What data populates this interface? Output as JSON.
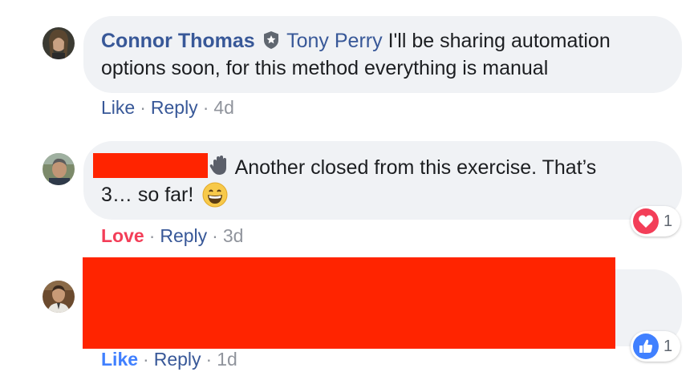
{
  "comments": [
    {
      "author": "Connor Thomas",
      "mention": "Tony Perry",
      "text_line1": "I'll be sharing automation",
      "text_line2": "options soon, for this method everything is manual",
      "actions": {
        "like": "Like",
        "reply": "Reply",
        "time": "4d"
      }
    },
    {
      "text_line1": "Another closed from this exercise. That’s",
      "text_line2": "3… so far!",
      "actions": {
        "like": "Love",
        "reply": "Reply",
        "time": "3d"
      },
      "reaction": {
        "type": "love",
        "count": "1"
      }
    },
    {
      "actions": {
        "like": "Like",
        "reply": "Reply",
        "time": "1d"
      },
      "reaction": {
        "type": "like",
        "count": "1"
      }
    }
  ],
  "colors": {
    "author": "#385898",
    "love": "#f33e58",
    "like_active": "#4080ff",
    "redaction": "#ff2400",
    "bubble": "#f0f2f5"
  },
  "icons": {
    "verified": "shield-badge-icon",
    "wave": "waving-hand-emoji",
    "grin": "grinning-face-emoji",
    "heart": "heart-icon",
    "thumb": "thumbs-up-icon"
  }
}
